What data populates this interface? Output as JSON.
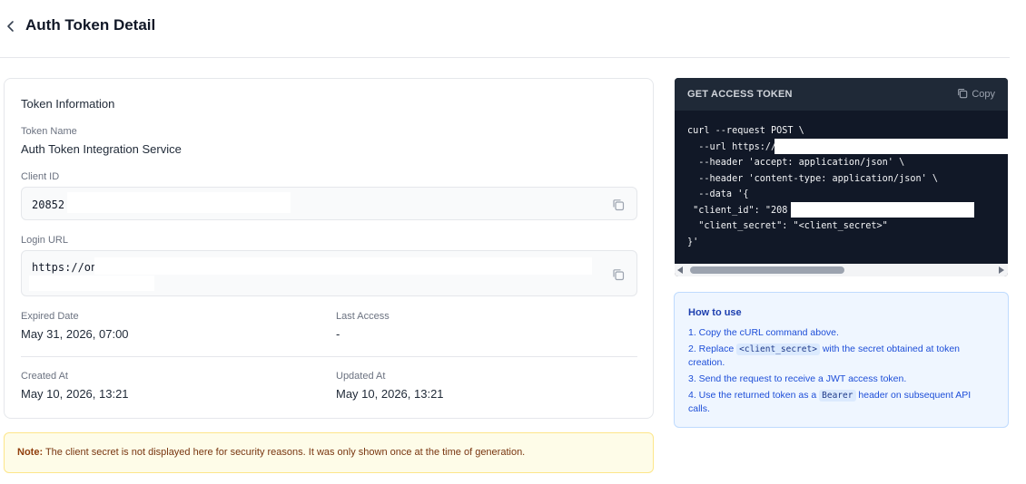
{
  "header": {
    "title": "Auth Token Detail"
  },
  "token_info": {
    "title": "Token Information",
    "token_name_label": "Token Name",
    "token_name": "Auth Token Integration Service",
    "client_id_label": "Client ID",
    "client_id": "20852",
    "login_url_label": "Login URL",
    "login_url": "https://on",
    "expired_label": "Expired Date",
    "expired": "May 31, 2026, 07:00",
    "last_access_label": "Last Access",
    "last_access": "-",
    "created_label": "Created At",
    "created": "May 10, 2026, 13:21",
    "updated_label": "Updated At",
    "updated": "May 10, 2026, 13:21"
  },
  "note": {
    "prefix": "Note:",
    "text": " The client secret is not displayed here for security reasons. It was only shown once at the time of generation."
  },
  "code": {
    "title": "GET ACCESS TOKEN",
    "copy_label": "Copy",
    "lines": [
      "curl --request POST \\",
      "  --url https://",
      "  --header 'accept: application/json' \\",
      "  --header 'content-type: application/json' \\",
      "  --data '{",
      " \"client_id\": \"208",
      "  \"client_secret\": \"<client_secret>\"",
      "}'"
    ]
  },
  "howto": {
    "title": "How to use",
    "step1": "1. Copy the cURL command above.",
    "step2_a": "2. Replace ",
    "step2_code": "<client_secret>",
    "step2_b": " with the secret obtained at token creation.",
    "step3": "3. Send the request to receive a JWT access token.",
    "step4_a": "4. Use the returned token as a ",
    "step4_code": "Bearer",
    "step4_b": " header on subsequent API calls."
  },
  "colors": {
    "accent": "#1d4ed8",
    "code_bg": "#111827",
    "note_bg": "#fefce8"
  }
}
